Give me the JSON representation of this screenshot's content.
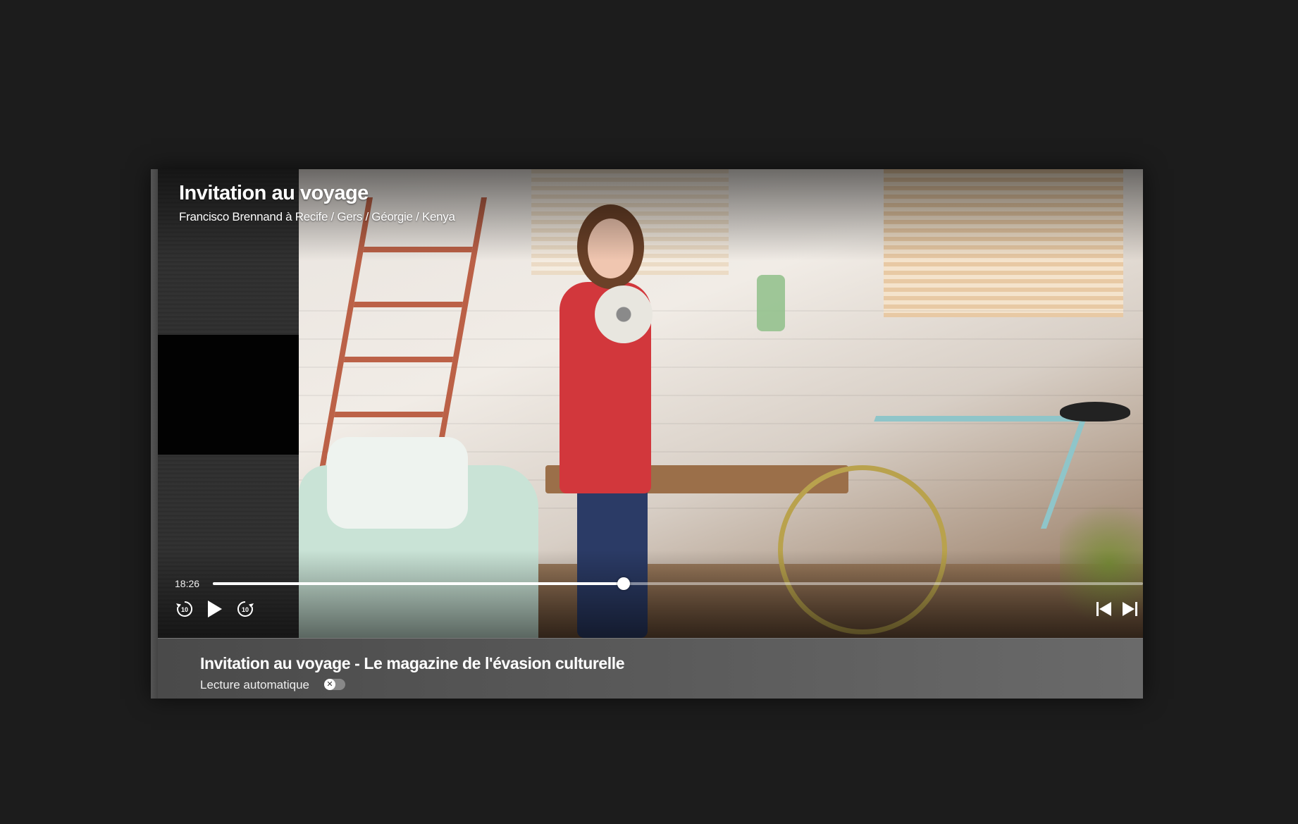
{
  "video": {
    "title": "Invitation au voyage",
    "subtitle": "Francisco Brennand à Recife / Gers / Géorgie / Kenya"
  },
  "controls": {
    "current_time": "18:26",
    "progress_fraction": 0.442,
    "rewind_label": "10",
    "forward_label": "10",
    "rewind_icon": "rewind-10-icon",
    "play_icon": "play-icon",
    "forward_icon": "forward-10-icon",
    "previous_icon": "skip-previous-icon",
    "next_icon": "skip-next-icon"
  },
  "info_bar": {
    "title": "Invitation au voyage - Le magazine de l'évasion culturelle",
    "autoplay_label": "Lecture automatique",
    "autoplay_on": false,
    "toggle_glyph": "✕"
  },
  "colors": {
    "background": "#1c1c1c",
    "progress": "#ffffff"
  }
}
